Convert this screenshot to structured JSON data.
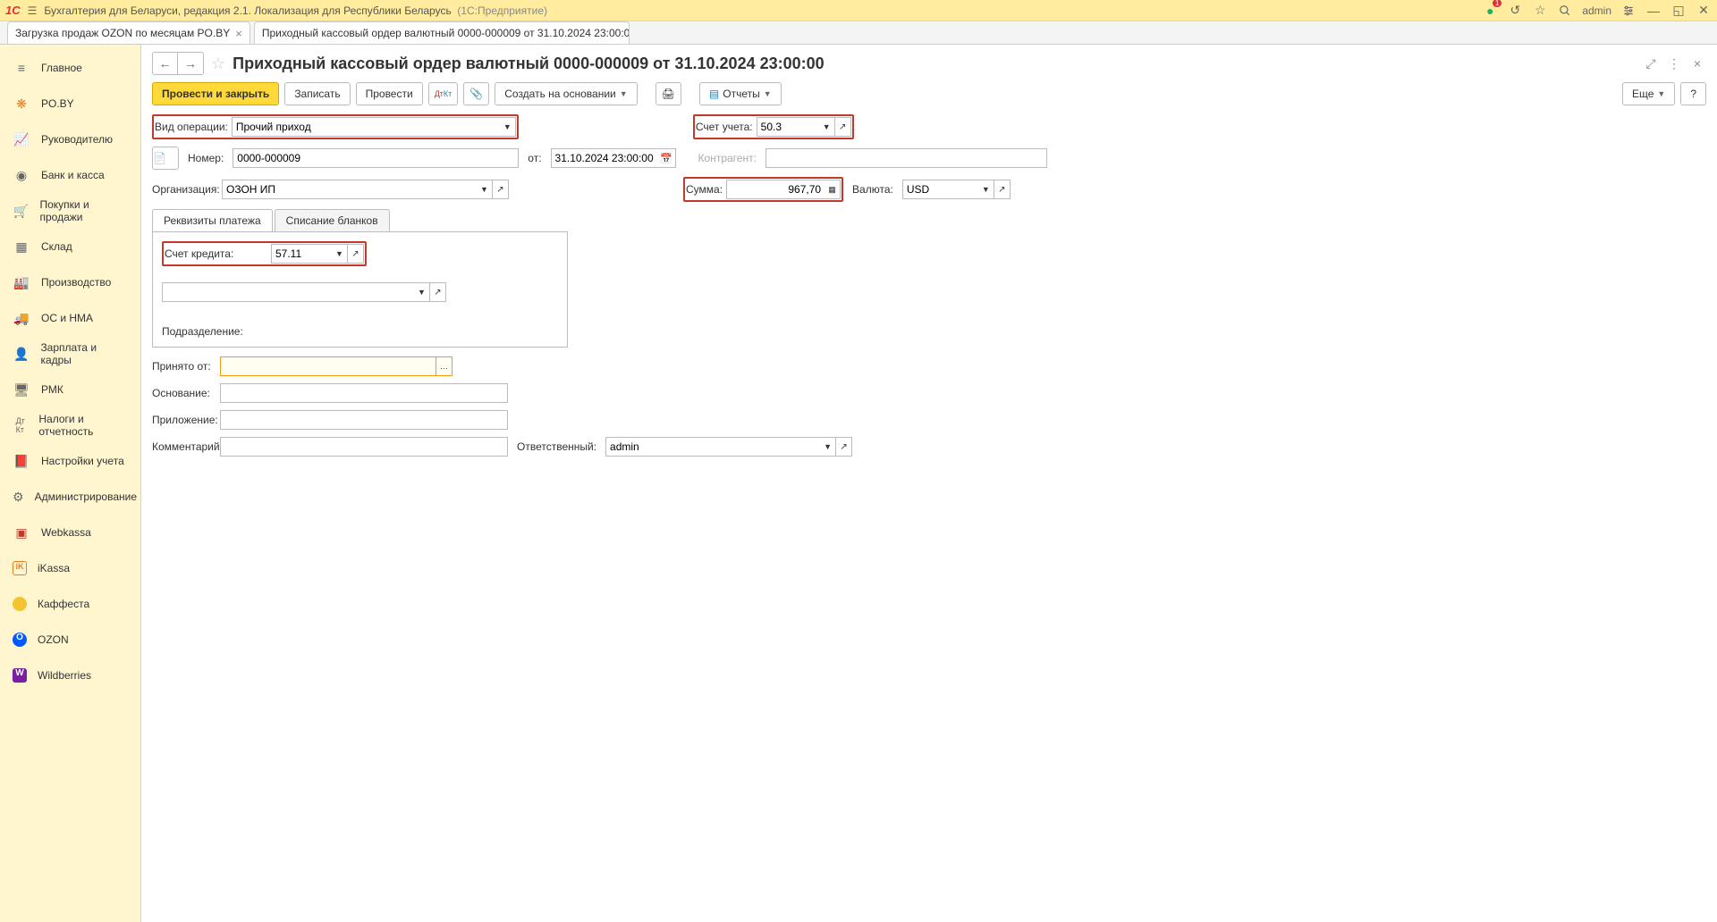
{
  "app": {
    "logo": "1C",
    "title": "Бухгалтерия для Беларуси, редакция 2.1. Локализация для Республики Беларусь",
    "platform": "(1С:Предприятие)",
    "user": "admin",
    "notif_count": "1"
  },
  "tabs": [
    {
      "label": "Загрузка продаж OZON по месяцам PO.BY",
      "active": false
    },
    {
      "label": "Приходный кассовый ордер валютный 0000-000009 от 31.10.2024 23:00:00",
      "active": true
    }
  ],
  "sidebar": [
    {
      "label": "Главное",
      "icon": "menu"
    },
    {
      "label": "PO.BY",
      "icon": "star-orange"
    },
    {
      "label": "Руководителю",
      "icon": "chart"
    },
    {
      "label": "Банк и касса",
      "icon": "bank"
    },
    {
      "label": "Покупки и продажи",
      "icon": "cart"
    },
    {
      "label": "Склад",
      "icon": "grid"
    },
    {
      "label": "Производство",
      "icon": "factory"
    },
    {
      "label": "ОС и НМА",
      "icon": "truck"
    },
    {
      "label": "Зарплата и кадры",
      "icon": "person"
    },
    {
      "label": "РМК",
      "icon": "register"
    },
    {
      "label": "Налоги и отчетность",
      "icon": "tax"
    },
    {
      "label": "Настройки учета",
      "icon": "book"
    },
    {
      "label": "Администрирование",
      "icon": "gear"
    },
    {
      "label": "Webkassa",
      "icon": "wk"
    },
    {
      "label": "iKassa",
      "icon": "ik"
    },
    {
      "label": "Каффеста",
      "icon": "kf"
    },
    {
      "label": "OZON",
      "icon": "ozon"
    },
    {
      "label": "Wildberries",
      "icon": "wb"
    }
  ],
  "page": {
    "title": "Приходный кассовый ордер валютный 0000-000009 от 31.10.2024 23:00:00"
  },
  "toolbar": {
    "post_close": "Провести и закрыть",
    "save": "Записать",
    "post": "Провести",
    "create_on_basis": "Создать на основании",
    "reports": "Отчеты",
    "more": "Еще",
    "help": "?"
  },
  "form": {
    "operation_label": "Вид операции:",
    "operation_value": "Прочий приход",
    "account_label": "Счет учета:",
    "account_value": "50.3",
    "number_label": "Номер:",
    "number_value": "0000-000009",
    "from_label": "от:",
    "date_value": "31.10.2024 23:00:00",
    "counterparty_label": "Контрагент:",
    "counterparty_value": "",
    "org_label": "Организация:",
    "org_value": "ОЗОН ИП",
    "sum_label": "Сумма:",
    "sum_value": "967,70",
    "currency_label": "Валюта:",
    "currency_value": "USD",
    "tabs": {
      "payment": "Реквизиты платежа",
      "blanks": "Списание бланков"
    },
    "credit_label": "Счет кредита:",
    "credit_value": "57.11",
    "subdiv_label": "Подразделение:",
    "received_label": "Принято от:",
    "received_value": "",
    "basis_label": "Основание:",
    "basis_value": "",
    "attachment_label": "Приложение:",
    "attachment_value": "",
    "comment_label": "Комментарий:",
    "comment_value": "",
    "responsible_label": "Ответственный:",
    "responsible_value": "admin"
  }
}
